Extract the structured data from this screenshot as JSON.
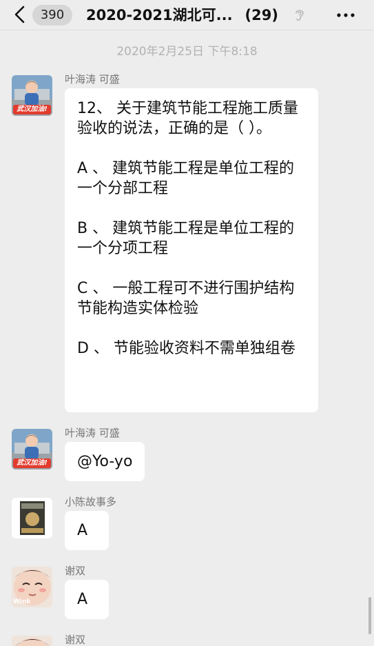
{
  "navbar": {
    "unread_count": "390",
    "title": "2020-2021湖北可...",
    "member_count": "(29)"
  },
  "chat": {
    "timestamp": "2020年2月25日 下午8:18",
    "messages": [
      {
        "sender": "叶海涛 可盛",
        "avatar_badge": "武汉加油!",
        "paragraphs": [
          "12、 关于建筑节能工程施工质量验收的说法，正确的是（ ）。",
          "A 、 建筑节能工程是单位工程的一个分部工程",
          "B 、 建筑节能工程是单位工程的一个分项工程",
          "C 、 一般工程可不进行围护结构节能构造实体检验",
          "D 、 节能验收资料不需单独组卷"
        ]
      },
      {
        "sender": "叶海涛 可盛",
        "avatar_badge": "武汉加油!",
        "text": "@Yo-yo"
      },
      {
        "sender": "小陈故事多",
        "text": "A"
      },
      {
        "sender": "谢双",
        "avatar_badge": "Wink",
        "text": "A"
      },
      {
        "sender": "谢双"
      }
    ]
  },
  "colors": {
    "background": "#ededed",
    "bubble": "#ffffff",
    "meta_text": "#b2b2b2",
    "badge_red": "#e23b2e"
  }
}
